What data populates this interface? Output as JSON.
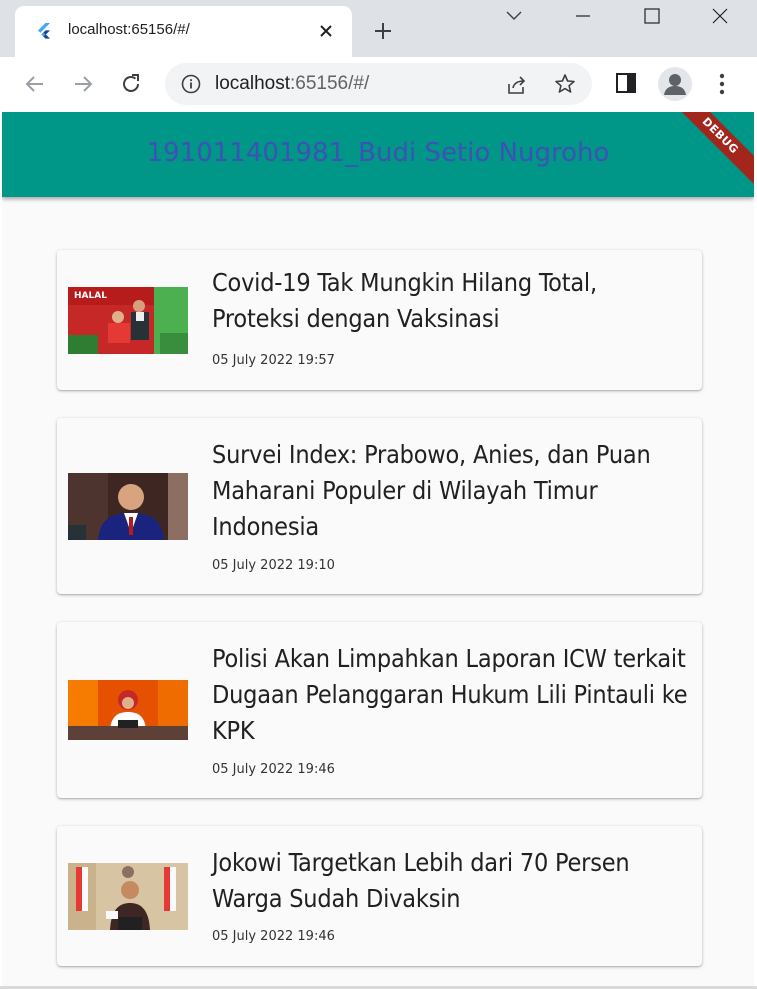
{
  "browser": {
    "tab_title": "localhost:65156/#/",
    "url_host": "localhost",
    "url_rest": ":65156/#/",
    "icons": [
      "flutter-favicon",
      "close-icon",
      "plus-icon",
      "chevron-down-icon",
      "minimize-icon",
      "maximize-icon",
      "close-window-icon",
      "back-arrow-icon",
      "forward-arrow-icon",
      "reload-icon",
      "info-icon",
      "share-icon",
      "star-icon",
      "side-panel-icon",
      "profile-icon",
      "more-vert-icon"
    ]
  },
  "app": {
    "title": "191011401981_Budi Setio Nugroho",
    "debug_banner": "DEBUG",
    "appbar_color": "#009688",
    "title_color": "#3f51b5",
    "articles": [
      {
        "title": "Covid-19 Tak Mungkin Hilang Total, Proteksi dengan Vaksinasi",
        "date": "05 July 2022 19:57",
        "thumb_badge": "HALAL"
      },
      {
        "title": "Survei Index: Prabowo, Anies, dan Puan Maharani Populer di Wilayah Timur Indonesia",
        "date": "05 July 2022 19:10"
      },
      {
        "title": "Polisi Akan Limpahkan Laporan ICW terkait Dugaan Pelanggaran Hukum Lili Pintauli ke KPK",
        "date": "05 July 2022 19:46"
      },
      {
        "title": "Jokowi Targetkan Lebih dari 70 Persen Warga Sudah Divaksin",
        "date": "05 July 2022 19:46"
      }
    ]
  }
}
